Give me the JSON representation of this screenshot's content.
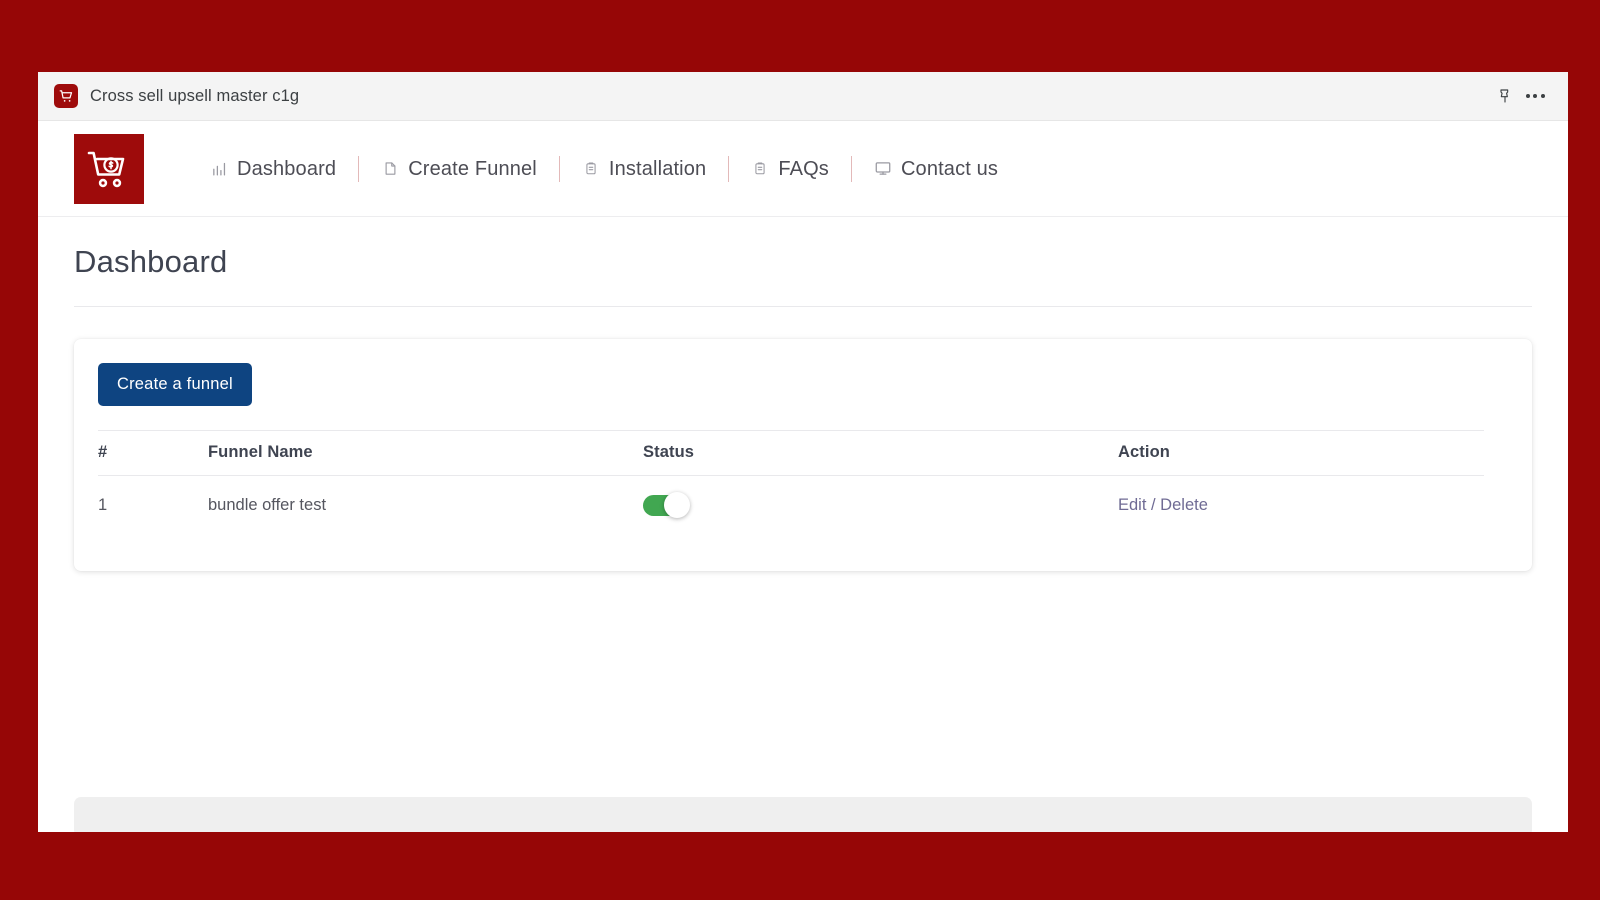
{
  "titlebar": {
    "app_icon": "shopping-cart-icon",
    "title": "Cross sell upsell master c1g",
    "pin_icon": "pin-icon",
    "more_icon": "more-options-icon"
  },
  "navbar": {
    "logo": "shopping-cart-dollar-logo",
    "items": [
      {
        "label": "Dashboard",
        "icon": "bar-chart-icon"
      },
      {
        "label": "Create Funnel",
        "icon": "document-icon"
      },
      {
        "label": "Installation",
        "icon": "clipboard-icon"
      },
      {
        "label": "FAQs",
        "icon": "clipboard-icon"
      },
      {
        "label": "Contact us",
        "icon": "monitor-icon"
      }
    ]
  },
  "page": {
    "title": "Dashboard"
  },
  "card": {
    "create_button_label": "Create a funnel",
    "table": {
      "headers": [
        "#",
        "Funnel Name",
        "Status",
        "Action"
      ],
      "rows": [
        {
          "num": "1",
          "name": "bundle offer test",
          "status_enabled": "on",
          "action": "Edit / Delete"
        }
      ]
    }
  },
  "colors": {
    "page_background": "#960606",
    "brand_red": "#9e0b0b",
    "primary_button": "#0e4481",
    "toggle_on": "#41a751",
    "action_link": "#6f6b94",
    "nav_separator": "#e3b9b9"
  }
}
